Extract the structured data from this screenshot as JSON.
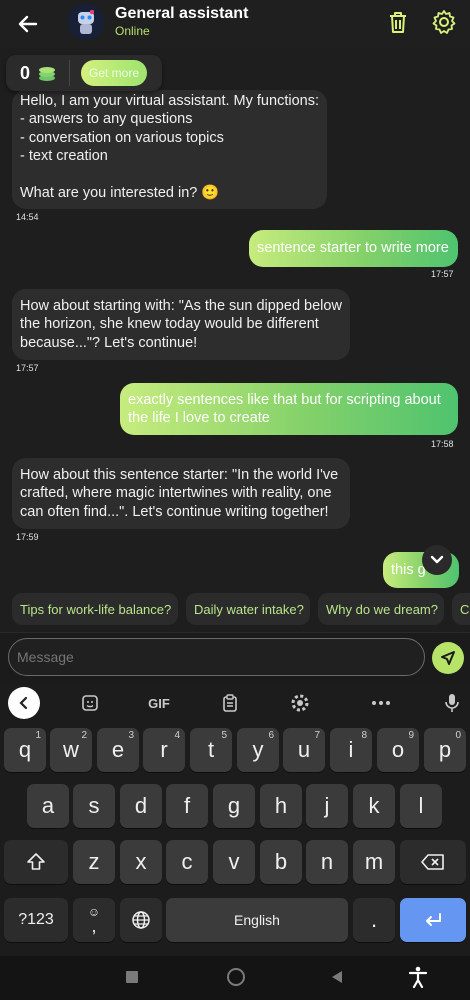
{
  "header": {
    "title": "General assistant",
    "status": "Online"
  },
  "coins": {
    "count": "0",
    "get_more_label": "Get more"
  },
  "messages": [
    {
      "from": "bot",
      "text": "Hello, I am your virtual assistant. My functions:\n- answers to any questions\n- conversation on various topics\n- text creation\n\nWhat are you interested in? 🙂",
      "time": "14:54"
    },
    {
      "from": "user",
      "text": "sentence starter to write more",
      "time": "17:57"
    },
    {
      "from": "bot",
      "text": "How about starting with: \"As the sun dipped below\nthe horizon, she knew today would be different\nbecause...\"? Let's continue!",
      "time": "17:57"
    },
    {
      "from": "user",
      "text": "exactly sentences like that but for scripting about\nthe life I love to create",
      "time": "17:58"
    },
    {
      "from": "bot",
      "text": "How about this sentence starter: \"In the world I've\ncrafted, where magic intertwines with reality, one\ncan often find...\". Let's continue writing together!",
      "time": "17:59"
    },
    {
      "from": "user",
      "text": "this g   t",
      "time": ""
    }
  ],
  "suggestions": [
    "Tips for work-life balance?",
    "Daily water intake?",
    "Why do we dream?",
    "Co"
  ],
  "input": {
    "placeholder": "Message"
  },
  "keyboard": {
    "toolbar": {
      "gif_label": "GIF"
    },
    "row1": [
      {
        "key": "q",
        "sup": "1"
      },
      {
        "key": "w",
        "sup": "2"
      },
      {
        "key": "e",
        "sup": "3"
      },
      {
        "key": "r",
        "sup": "4"
      },
      {
        "key": "t",
        "sup": "5"
      },
      {
        "key": "y",
        "sup": "6"
      },
      {
        "key": "u",
        "sup": "7"
      },
      {
        "key": "i",
        "sup": "8"
      },
      {
        "key": "o",
        "sup": "9"
      },
      {
        "key": "p",
        "sup": "0"
      }
    ],
    "row2": [
      "a",
      "s",
      "d",
      "f",
      "g",
      "h",
      "j",
      "k",
      "l"
    ],
    "row3": [
      "z",
      "x",
      "c",
      "v",
      "b",
      "n",
      "m"
    ],
    "symbols_label": "?123",
    "comma_label": ",",
    "space_label": "English",
    "period_label": "."
  }
}
